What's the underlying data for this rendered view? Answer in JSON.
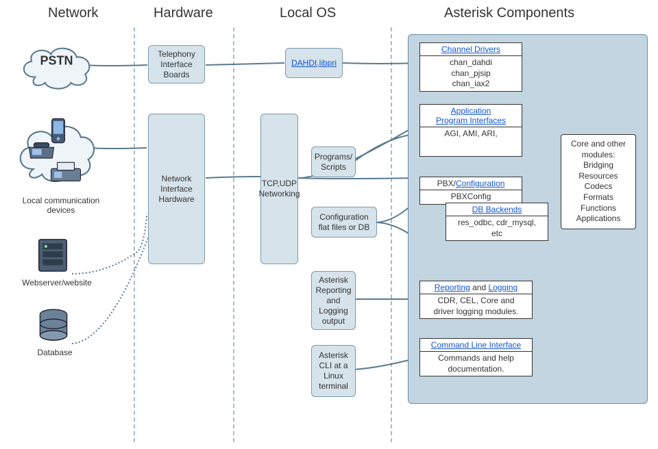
{
  "columns": {
    "network": "Network",
    "hardware": "Hardware",
    "localos": "Local OS",
    "asterisk": "Asterisk Components"
  },
  "network": {
    "pstn": "PSTN",
    "localdev": "Local communication\ndevices",
    "webserver": "Webserver/website",
    "database": "Database"
  },
  "hardware": {
    "telephony": "Telephony\nInterface\nBoards",
    "nic": "Network\nInterface\nHardware"
  },
  "localos": {
    "dahdi": "DAHDI,libpri",
    "tcp": "TCP,UDP\nNetworking",
    "programs": "Programs/\nScripts",
    "config": "Configuration\nflat files or DB",
    "reporting": "Asterisk\nReporting\nand\nLogging\noutput",
    "cli": "Asterisk\nCLI at a\nLinux\nterminal"
  },
  "asterisk": {
    "channel": {
      "head": "Channel Drivers",
      "body": "chan_dahdi\nchan_pjsip\nchan_iax2"
    },
    "api": {
      "head": "Application\nProgram Interfaces",
      "body": "AGI, AMI, ARI,"
    },
    "pbx": {
      "head_prefix": "PBX/",
      "head_link": "Configuration",
      "body": "PBXConfig"
    },
    "db": {
      "head": "DB Backends",
      "body": "res_odbc, cdr_mysql,\netc"
    },
    "rep": {
      "head_l1": "Reporting",
      "head_mid": " and ",
      "head_l2": "Logging",
      "body": "CDR, CEL, Core and\ndriver logging modules."
    },
    "cli": {
      "head": "Command Line Interface",
      "body": "Commands and help\ndocumentation."
    },
    "core": "Core and other\nmodules:\nBridging\nResources\nCodecs\nFormats\nFunctions\nApplications"
  }
}
